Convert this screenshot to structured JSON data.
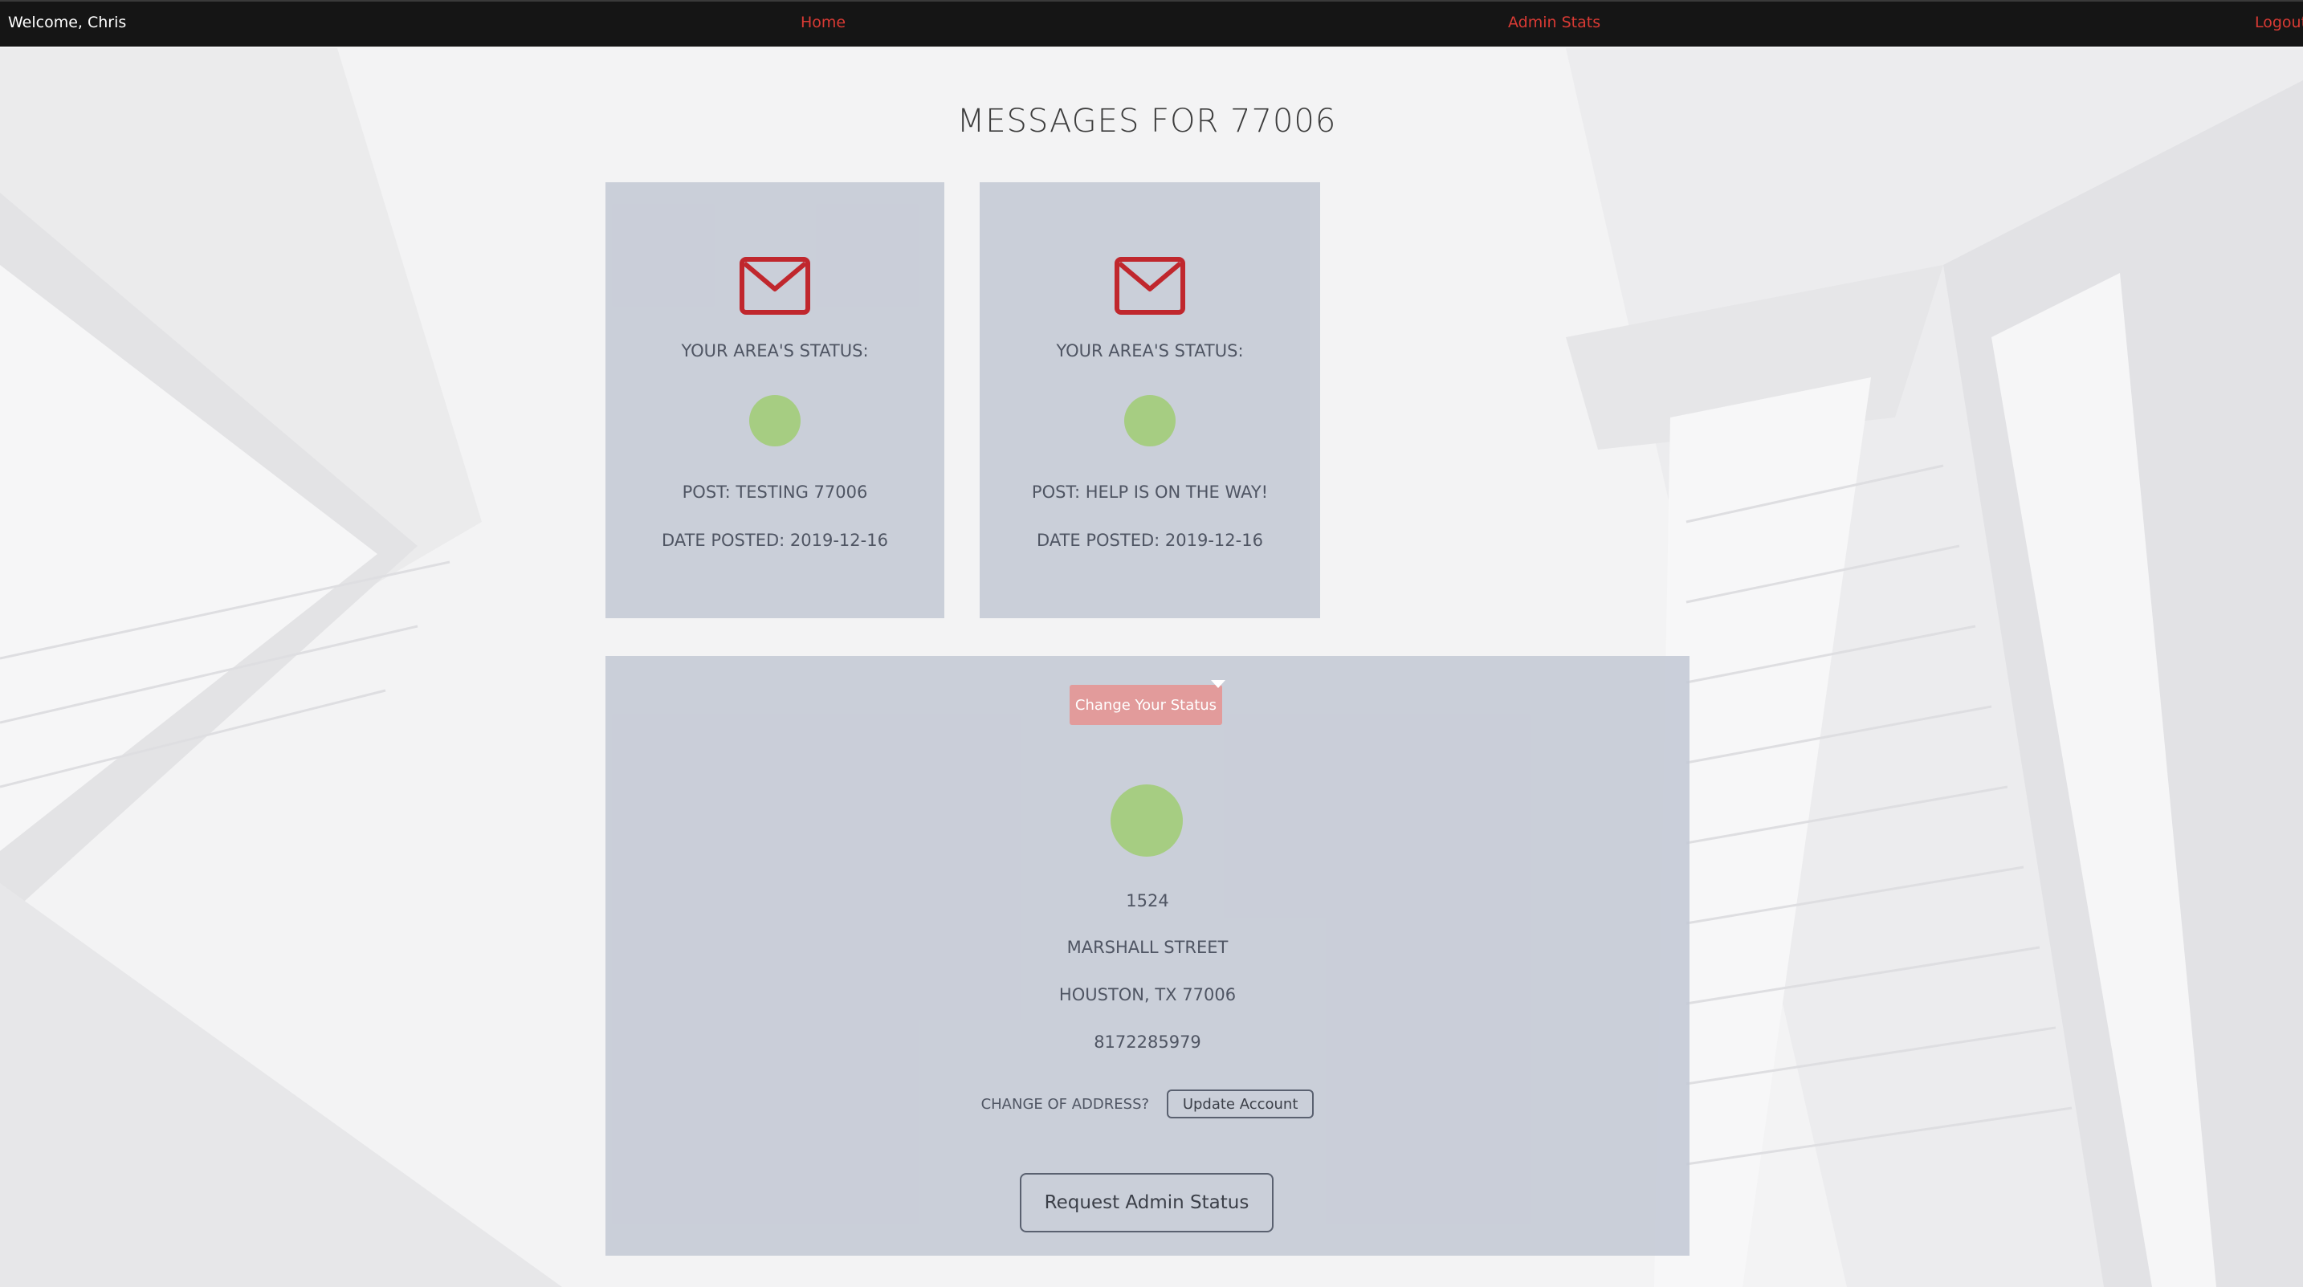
{
  "navbar": {
    "welcome": "Welcome, Chris",
    "home": "Home",
    "admin_stats": "Admin Stats",
    "logout": "Logout"
  },
  "page": {
    "title": "MESSAGES FOR 77006"
  },
  "messages": [
    {
      "status_label": "YOUR AREA'S STATUS:",
      "post": "POST: TESTING 77006",
      "date": "DATE POSTED: 2019-12-16",
      "status_color": "#a6cd82"
    },
    {
      "status_label": "YOUR AREA'S STATUS:",
      "post": "POST: HELP IS ON THE WAY!",
      "date": "DATE POSTED: 2019-12-16",
      "status_color": "#a6cd82"
    }
  ],
  "account": {
    "change_status_label": "Change Your Status",
    "status_color": "#a6cd82",
    "street_number": "1524",
    "street": "MARSHALL STREET",
    "city_line": "HOUSTON, TX 77006",
    "phone": "8172285979",
    "change_address_label": "CHANGE OF ADDRESS?",
    "update_label": "Update Account",
    "request_admin_label": "Request Admin Status"
  },
  "colors": {
    "accent": "#d93a34",
    "envelope": "#c0272d",
    "navbar_bg": "#151515",
    "card_bg": "#c4c9d5",
    "status_ok": "#a6cd82",
    "button_pink": "#e29b9b"
  },
  "icons": {
    "message": "envelope-icon",
    "dropdown": "caret-down-icon"
  }
}
